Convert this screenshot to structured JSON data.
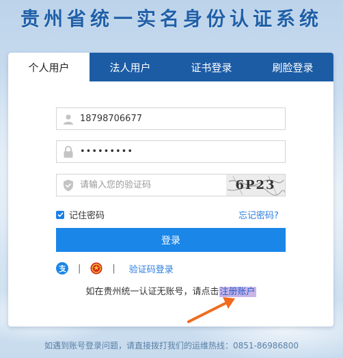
{
  "title": "贵州省统一实名身份认证系统",
  "tabs": [
    {
      "label": "个人用户",
      "active": true
    },
    {
      "label": "法人用户",
      "active": false
    },
    {
      "label": "证书登录",
      "active": false
    },
    {
      "label": "刷脸登录",
      "active": false
    }
  ],
  "form": {
    "username": {
      "value": "18798706677",
      "icon": "user-icon"
    },
    "password": {
      "value": "•••••••••",
      "icon": "lock-icon"
    },
    "captcha": {
      "placeholder": "请输入您的验证码",
      "icon": "shield-icon",
      "image_text": "6P23"
    },
    "remember_label": "记住密码",
    "remember_checked": true,
    "forgot_label": "忘记密码?",
    "login_label": "登录"
  },
  "alt_login": {
    "alipay_icon": "alipay-icon",
    "emblem_icon": "national-emblem-icon",
    "separator": "|",
    "code_login_label": "验证码登录"
  },
  "register": {
    "prefix": "如在贵州统一认证无账号，请点击",
    "link": "注册账户"
  },
  "footer": "如遇到账号登录问题，请直接拨打我们的运维热线：0851-86986800",
  "colors": {
    "brand_blue": "#1c5ca5",
    "button_blue": "#1a86e8",
    "link_blue": "#2a7de1",
    "arrow_orange": "#f26a1b",
    "highlight_purple": "#c8b4e8"
  }
}
